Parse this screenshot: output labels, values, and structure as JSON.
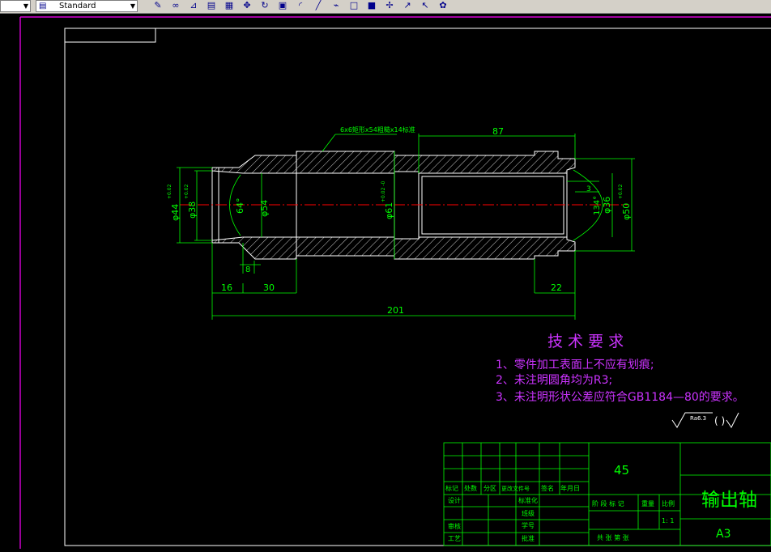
{
  "toolbar": {
    "style_dropdown_value": "Standard",
    "icons": [
      "pencil-icon",
      "link-icon",
      "dimension-icon",
      "text-style-icon",
      "grid-icon",
      "pan-icon",
      "orbit-icon",
      "table-icon",
      "arc-icon",
      "line-icon",
      "polyline-icon",
      "rectangle-icon",
      "region-icon",
      "break-icon",
      "leader-icon",
      "leader2-icon",
      "paint-icon"
    ]
  },
  "drawing": {
    "colors": {
      "outline": "#ffffff",
      "dimension": "#00ff00",
      "centerline": "#ff0000",
      "notes": "#cc33ff",
      "frame": "#ff00ff"
    },
    "thread_callout": "6x6矩形x54粗糙x14标准",
    "dims": {
      "d87": "87",
      "d16": "16",
      "d30": "30",
      "d8": "8",
      "d22": "22",
      "d201": "201",
      "d3": "3",
      "dia44": "φ44",
      "dia44_tol": "+0.02",
      "dia38": "φ38",
      "dia38_tol": "+0.02",
      "ang64": "64°",
      "dia54": "φ54",
      "dia61": "φ61",
      "dia61_tol": "+0.02 -0",
      "ang134": "134°",
      "dia36": "φ36",
      "dia50": "φ50",
      "dia50_tol": "+0.02"
    },
    "requirements": {
      "title": "技 术 要 求",
      "items": [
        "1、零件加工表面上不应有划痕;",
        "2、未注明圆角均为R3;",
        "3、未注明形状公差应符合GB1184—80的要求。"
      ]
    },
    "roughness": {
      "value": "Ra6.3",
      "paren": "(    )"
    },
    "title_block": {
      "material": "45",
      "part_name": "输出轴",
      "sheet": "A3",
      "scale_value": "1: 1",
      "labels": {
        "mark": "标记",
        "count": "处数",
        "zone": "分区",
        "change_doc": "更改文件号",
        "signature": "签名",
        "date": "年月日",
        "design": "设计",
        "standardize": "标准化",
        "check": "审核",
        "process": "工艺",
        "class": "班级",
        "student_no": "学号",
        "approve": "批准",
        "stage_mark": "阶 段 标 记",
        "weight": "重量",
        "scale": "比例",
        "total_sheets": "共  张  第  张"
      }
    }
  }
}
